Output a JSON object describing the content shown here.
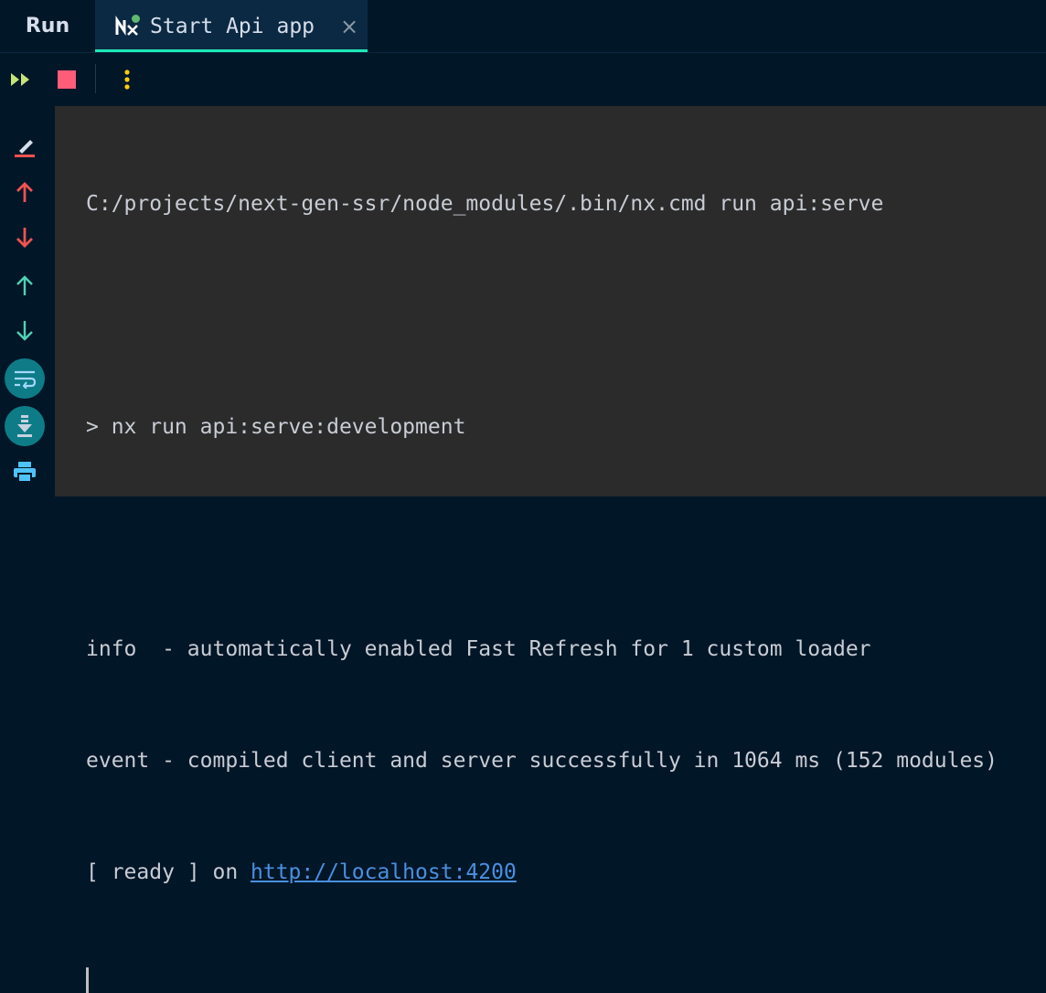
{
  "tabs": {
    "run_label": "Run",
    "active_label": "Start Api app",
    "close_glyph": "×",
    "active_icon": "nx-icon",
    "accent_color": "#1de9b6"
  },
  "toolbar": {
    "rerun_icon": "rerun-icon",
    "stop_icon": "stop-icon",
    "more_icon": "more-vertical-icon",
    "stop_color": "#ff5c7a"
  },
  "sidebar": {
    "items": [
      {
        "icon": "clear-output-icon"
      },
      {
        "icon": "previous-occurrence-icon"
      },
      {
        "icon": "next-occurrence-icon"
      },
      {
        "icon": "scroll-up-icon"
      },
      {
        "icon": "scroll-down-icon"
      },
      {
        "icon": "soft-wrap-icon"
      },
      {
        "icon": "scroll-to-end-icon"
      },
      {
        "icon": "print-icon"
      }
    ]
  },
  "console": {
    "lines": [
      "C:/projects/next-gen-ssr/node_modules/.bin/nx.cmd run api:serve",
      "",
      "> nx run api:serve:development",
      "",
      "info  - automatically enabled Fast Refresh for 1 custom loader",
      "event - compiled client and server successfully in 1064 ms (152 modules)"
    ],
    "ready_prefix": "[ ready ] on ",
    "ready_link": "http://localhost:4200"
  }
}
